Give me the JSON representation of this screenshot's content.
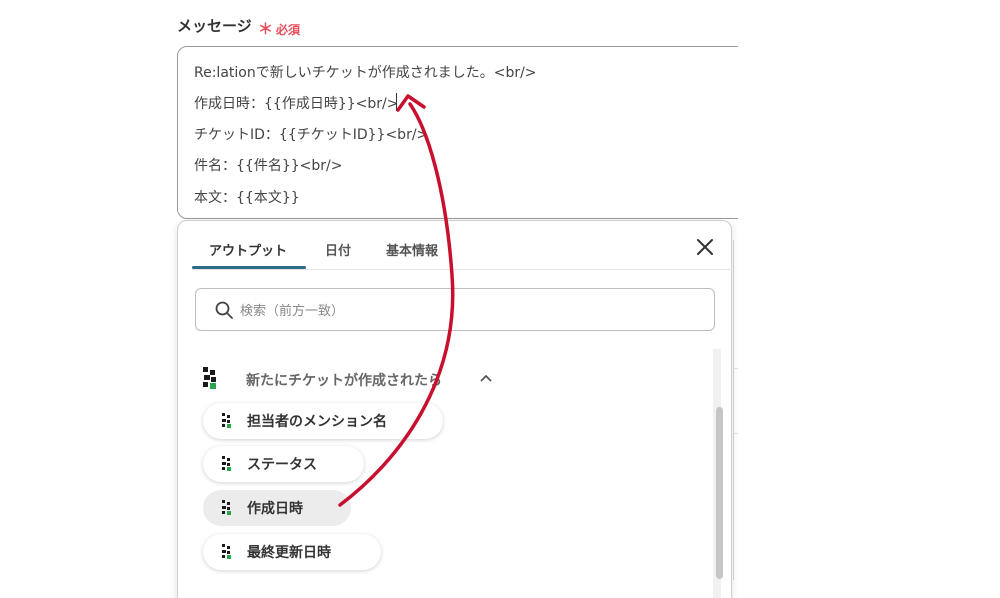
{
  "field": {
    "label": "メッセージ",
    "required_mark": "＊",
    "required_text": "必須"
  },
  "message": {
    "lines": [
      "Re:lationで新しいチケットが作成されました。<br/>",
      "作成日時：{{作成日時}}<br/>",
      "チケットID：{{チケットID}}<br/>",
      "件名：{{件名}}<br/>",
      "本文：{{本文}}"
    ]
  },
  "panel": {
    "tabs": [
      {
        "label": "アウトプット",
        "active": true
      },
      {
        "label": "日付",
        "active": false
      },
      {
        "label": "基本情報",
        "active": false
      }
    ],
    "close_icon": "close-icon",
    "search": {
      "placeholder": "検索（前方一致）",
      "value": "",
      "icon": "search-icon"
    },
    "group": {
      "title": "新たにチケットが作成されたら",
      "expanded": true,
      "icon": "relation-logo-icon",
      "items": [
        {
          "label": "担当者のメンション名",
          "highlighted": false
        },
        {
          "label": "ステータス",
          "highlighted": false
        },
        {
          "label": "作成日時",
          "highlighted": true
        },
        {
          "label": "最終更新日時",
          "highlighted": false
        }
      ]
    }
  },
  "colors": {
    "required": "#e8505b",
    "tab_underline": "#2b6c86",
    "arrow": "#c8102e",
    "logo_green": "#2aa54a",
    "chip_hover": "#ececec"
  }
}
